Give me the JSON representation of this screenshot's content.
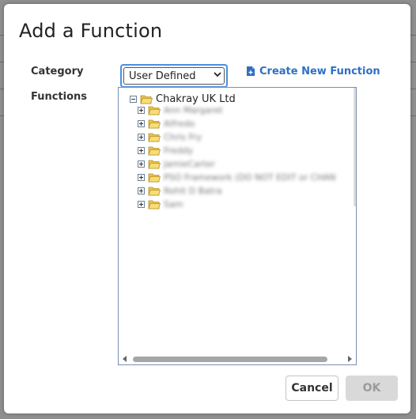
{
  "dialog": {
    "title": "Add a Function",
    "category_label": "Category",
    "functions_label": "Functions",
    "category_select": {
      "selected": "User Defined"
    },
    "create_link": {
      "label": "Create New Function",
      "icon": "new-file-icon",
      "color": "#2f6fc2"
    },
    "tree": {
      "root": {
        "label": "Chakray UK Ltd",
        "expanded": true
      },
      "items": [
        {
          "label": "Ann Margaret"
        },
        {
          "label": "Alfredo"
        },
        {
          "label": "Chris Fry"
        },
        {
          "label": "Freddy"
        },
        {
          "label": "JamieCarter"
        },
        {
          "label": "PSO Framework (DO NOT EDIT or CHAN"
        },
        {
          "label": "Rohit D Batra"
        },
        {
          "label": "Sam"
        }
      ]
    },
    "buttons": {
      "cancel": "Cancel",
      "ok": "OK"
    }
  },
  "colors": {
    "accent": "#4a90e2",
    "folder": "#f2d75c",
    "link": "#2f6fc2"
  }
}
